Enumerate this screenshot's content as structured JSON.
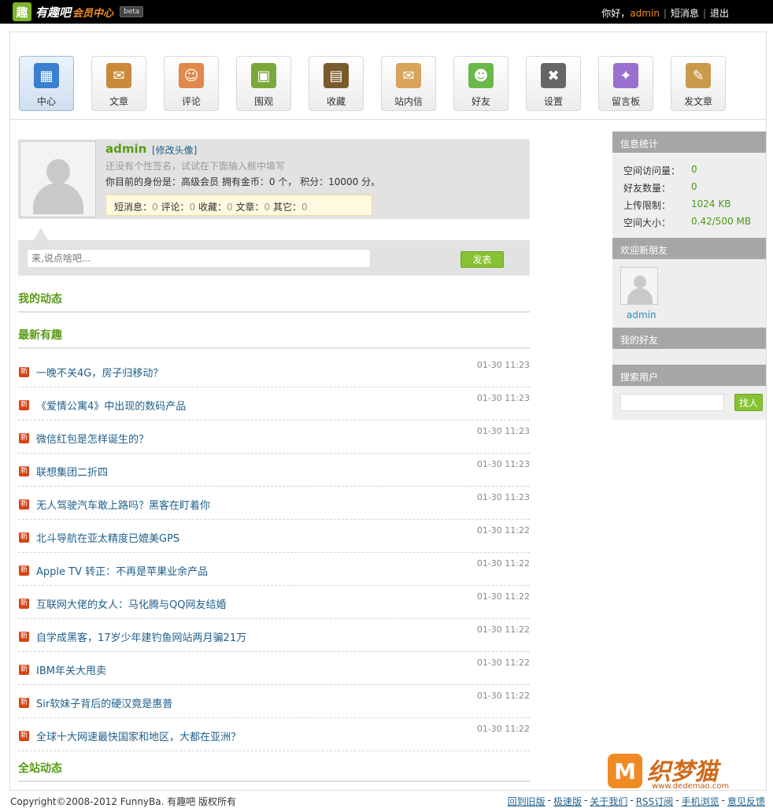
{
  "header": {
    "logo_mark": "趣",
    "logo_name": "有趣吧",
    "logo_sub": "会员中心",
    "logo_beta": "beta",
    "greeting": "你好，",
    "username": "admin",
    "messages": "短消息",
    "logout": "退出",
    "sep": "|"
  },
  "nav": [
    {
      "label": "中心",
      "icon": "shop-icon",
      "color": "#3a7fd0"
    },
    {
      "label": "文章",
      "icon": "inbox-icon",
      "color": "#c98a3a"
    },
    {
      "label": "评论",
      "icon": "user-icon",
      "color": "#e0894a"
    },
    {
      "label": "围观",
      "icon": "picture-icon",
      "color": "#7aa83a"
    },
    {
      "label": "收藏",
      "icon": "bookshelf-icon",
      "color": "#7b5a2e"
    },
    {
      "label": "站内信",
      "icon": "envelope-icon",
      "color": "#d8a35a"
    },
    {
      "label": "好友",
      "icon": "friends-icon",
      "color": "#6bb84a"
    },
    {
      "label": "设置",
      "icon": "tools-icon",
      "color": "#666666"
    },
    {
      "label": "留言板",
      "icon": "magic-wand-icon",
      "color": "#9a6fd0"
    },
    {
      "label": "发文章",
      "icon": "clipboard-icon",
      "color": "#c89a4a"
    }
  ],
  "profile": {
    "name": "admin",
    "edit_avatar": "[修改头像]",
    "signature_hint": "还没有个性签名，试试在下面输入框中填写",
    "identity": "你目前的身份是：高级会员 拥有金币：0 个， 积分：10000 分。",
    "stats": {
      "messages_label": "短消息：",
      "messages": "0",
      "comments_label": " 评论：",
      "comments": "0",
      "favorites_label": " 收藏：",
      "favorites": "0",
      "articles_label": " 文章：",
      "articles": "0",
      "other_label": " 其它：",
      "other": "0"
    }
  },
  "post": {
    "placeholder": "来,说点啥吧...",
    "submit": "发表"
  },
  "sections": {
    "my_activity": "我的动态",
    "latest": "最新有趣",
    "site_activity": "全站动态"
  },
  "news_badge": "新",
  "news": [
    {
      "title": "一晚不关4G，房子归移动？",
      "time": "01-30 11:23"
    },
    {
      "title": "《爱情公寓4》中出现的数码产品",
      "time": "01-30 11:23"
    },
    {
      "title": "微信红包是怎样诞生的？",
      "time": "01-30 11:23"
    },
    {
      "title": "联想集团二折四",
      "time": "01-30 11:23"
    },
    {
      "title": "无人驾驶汽车敢上路吗？黑客在盯着你",
      "time": "01-30 11:23"
    },
    {
      "title": "北斗导航在亚太精度已媲美GPS",
      "time": "01-30 11:22"
    },
    {
      "title": "Apple TV 转正：不再是苹果业余产品",
      "time": "01-30 11:22"
    },
    {
      "title": "互联网大佬的女人：马化腾与QQ网友结婚",
      "time": "01-30 11:22"
    },
    {
      "title": "自学成黑客，17岁少年建钓鱼网站两月骗21万",
      "time": "01-30 11:22"
    },
    {
      "title": "IBM年关大甩卖",
      "time": "01-30 11:22"
    },
    {
      "title": "Sir软妹子背后的硬汉竟是惠普",
      "time": "01-30 11:22"
    },
    {
      "title": "全球十大网速最快国家和地区，大都在亚洲？",
      "time": "01-30 11:22"
    }
  ],
  "sidebar": {
    "info_title": "信息统计",
    "stats": [
      {
        "label": "空间访问量：",
        "value": "0"
      },
      {
        "label": "好友数量：",
        "value": "0"
      },
      {
        "label": "上传限制：",
        "value": "1024 KB"
      },
      {
        "label": "空间大小：",
        "value": "0.42/500 MB"
      }
    ],
    "welcome_title": "欢迎新朋友",
    "new_friend": "admin",
    "my_friends_title": "我的好友",
    "search_title": "搜索用户",
    "search_button": "找人"
  },
  "watermark": {
    "mark": "M",
    "text": "织梦猫",
    "url": "www.dedemao.com"
  },
  "footer": {
    "copyright": "Copyright©2008-2012 FunnyBa. 有趣吧 版权所有",
    "links": [
      "回到旧版",
      "极速版",
      "关于我们",
      "RSS订阅",
      "手机浏览",
      "意见反馈"
    ],
    "dash": "-"
  }
}
